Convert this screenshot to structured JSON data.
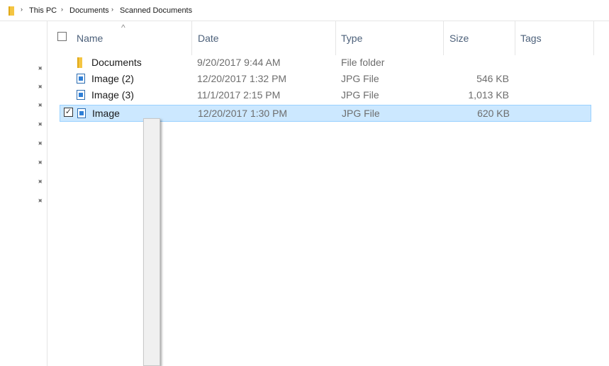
{
  "breadcrumb": {
    "items": [
      "This PC",
      "Documents",
      "Scanned Documents"
    ],
    "separator": "›"
  },
  "nav": {
    "pin_glyph": "✦",
    "pin_count": 8
  },
  "columns": {
    "name": "Name",
    "date": "Date",
    "type": "Type",
    "size": "Size",
    "tags": "Tags",
    "sort_glyph": "^"
  },
  "files": [
    {
      "name": "Documents",
      "date": "9/20/2017 9:44 AM",
      "type": "File folder",
      "size": "",
      "icon": "folder-icon",
      "selected": false
    },
    {
      "name": "Image (2)",
      "date": "12/20/2017 1:32 PM",
      "type": "JPG File",
      "size": "546 KB",
      "icon": "jpg-file-icon",
      "selected": false
    },
    {
      "name": "Image (3)",
      "date": "11/1/2017 2:15 PM",
      "type": "JPG File",
      "size": "1,013 KB",
      "icon": "jpg-file-icon",
      "selected": false
    },
    {
      "name": "Image",
      "date": "12/20/2017 1:30 PM",
      "type": "JPG File",
      "size": "620 KB",
      "icon": "jpg-file-icon",
      "selected": true
    }
  ],
  "row_check_glyph": "✓",
  "colors": {
    "selection_bg": "#cce8ff",
    "selection_border": "#99d1ff",
    "folder": "#f4c542",
    "header_text": "#4c607a"
  }
}
